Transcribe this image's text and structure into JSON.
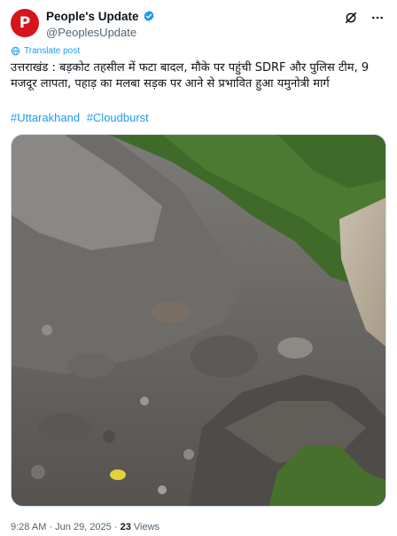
{
  "post": {
    "author": {
      "display_name": "People's Update",
      "handle": "@PeoplesUpdate",
      "avatar_letter": "P",
      "avatar_color": "#d6141b",
      "verified_color": "#1d9bf0"
    },
    "translate_label": "Translate post",
    "text": "उत्तराखंड : बड़कोट तहसील में फटा बादल, मौके पर पहुंची SDRF और पुलिस टीम, 9 मजदूर लापता, पहाड़ का मलबा सड़क पर आने से प्रभावित हुआ यमुनोत्री मार्ग",
    "hashtags": [
      "#Uttarakhand",
      "#Cloudburst"
    ],
    "meta": {
      "time": "9:28 AM",
      "separator": "·",
      "date": "Jun 29, 2025",
      "views_count": "23",
      "views_label": "Views"
    },
    "accent_color": "#1d9bf0"
  }
}
